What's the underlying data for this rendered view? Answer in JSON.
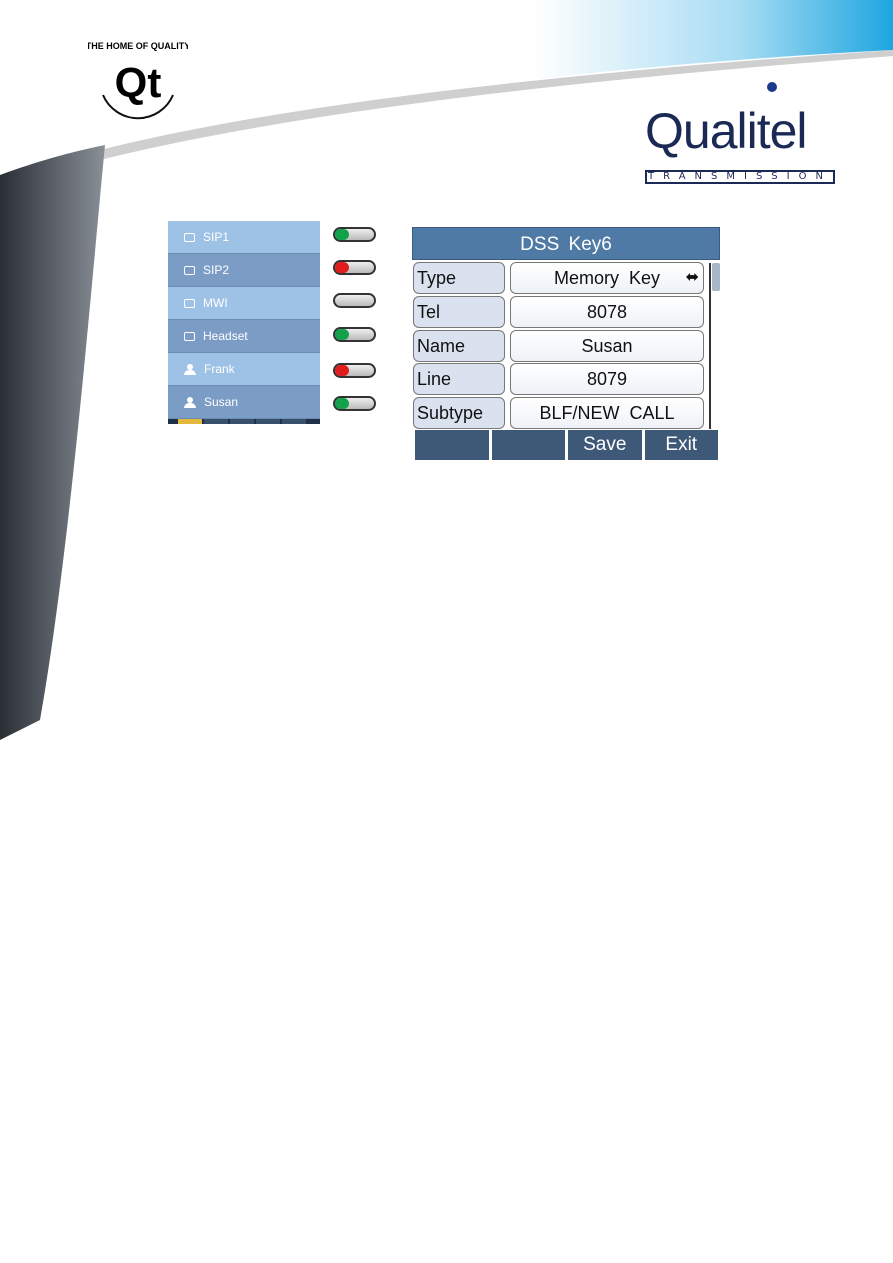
{
  "colors": {
    "accent": "#4f7aa6",
    "navy": "#1b2a55",
    "green": "#12a24a",
    "red": "#e01c1c"
  },
  "logos": {
    "qt": "THE HOME OF QUALITY Qt",
    "qualitel": "Qualitel",
    "qualitel_sub": "TRANSMISSION"
  },
  "dss_list": [
    {
      "label": "SIP1",
      "icon": "line-icon",
      "status": "green"
    },
    {
      "label": "SIP2",
      "icon": "line-icon",
      "status": "red"
    },
    {
      "label": "MWI",
      "icon": "key-icon",
      "status": "off"
    },
    {
      "label": "Headset",
      "icon": "key-icon",
      "status": "green"
    },
    {
      "label": "Frank",
      "icon": "user-icon",
      "status": "red"
    },
    {
      "label": "Susan",
      "icon": "user-icon",
      "status": "green"
    }
  ],
  "screen": {
    "title": "DSS Key6",
    "fields": [
      {
        "label": "Type",
        "value": "Memory Key",
        "icon": "left-right-arrow-icon"
      },
      {
        "label": "Tel",
        "value": "8078"
      },
      {
        "label": "Name",
        "value": "Susan"
      },
      {
        "label": "Line",
        "value": "8079"
      },
      {
        "label": "Subtype",
        "value": "BLF/NEW CALL"
      }
    ],
    "softkeys": [
      "",
      "",
      "Save",
      "Exit"
    ]
  }
}
